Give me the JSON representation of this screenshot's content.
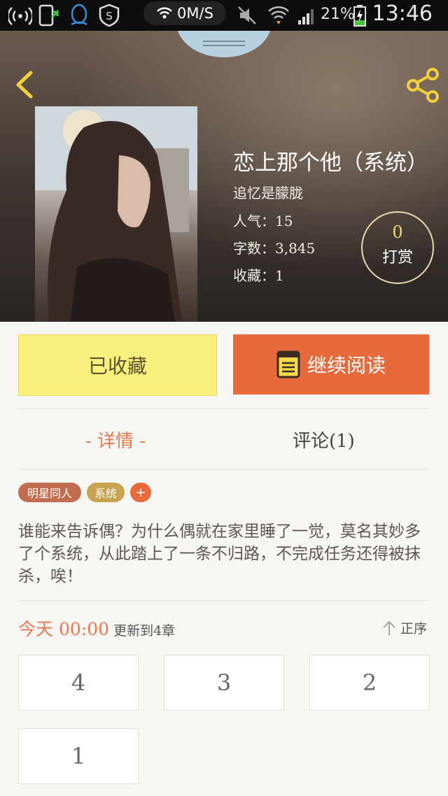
{
  "status_bar": {
    "speed": "0M/S",
    "battery_percent": "21%",
    "time": "13:46"
  },
  "book": {
    "title": "恋上那个他（系统）",
    "author": "追忆是朦胧",
    "popularity": "人气：15",
    "word_count": "字数：3,845",
    "favorites": "收藏：1",
    "reward_count": "0",
    "reward_label": "打赏"
  },
  "actions": {
    "collected_label": "已收藏",
    "continue_label": "继续阅读"
  },
  "tabs": {
    "detail": "- 详情 -",
    "comments": "评论(1)"
  },
  "tags": [
    "明星同人",
    "系统",
    "+"
  ],
  "description": "谁能来告诉偶？为什么偶就在家里睡了一觉，莫名其妙多了个系统，从此踏上了一条不归路，不完成任务还得被抹杀，唉！",
  "update": {
    "day": "今天",
    "time": "00:00",
    "text": "更新到4章",
    "sort_label": "正序"
  },
  "chapters": [
    "4",
    "3",
    "2",
    "1"
  ]
}
